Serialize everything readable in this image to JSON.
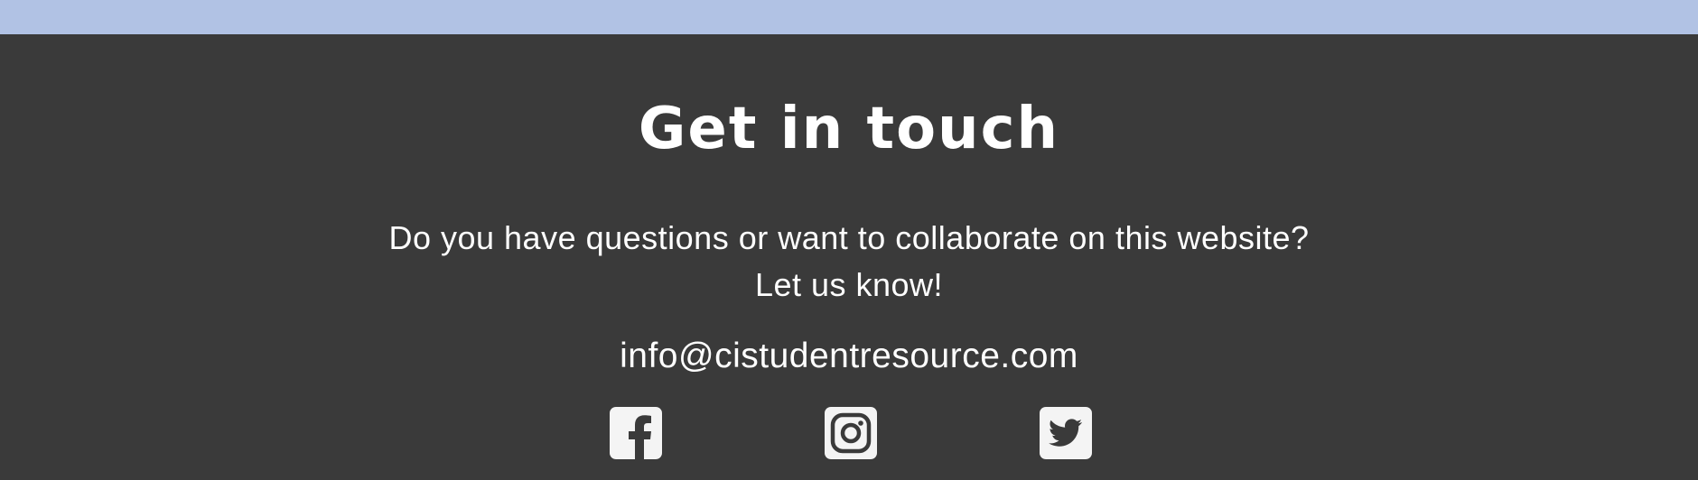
{
  "footer": {
    "title": "Get in touch",
    "subtitle_line1": "Do you have questions or want to collaborate on this website?",
    "subtitle_line2": "Let us know!",
    "email": "info@cistudentresource.com",
    "social": [
      {
        "name": "facebook",
        "icon": "facebook-icon"
      },
      {
        "name": "instagram",
        "icon": "instagram-icon"
      },
      {
        "name": "twitter",
        "icon": "twitter-icon"
      }
    ]
  },
  "colors": {
    "top_band": "#b1c2e4",
    "background": "#3a3a3a",
    "text": "#ffffff",
    "icon_bg": "#f4f4f4"
  }
}
